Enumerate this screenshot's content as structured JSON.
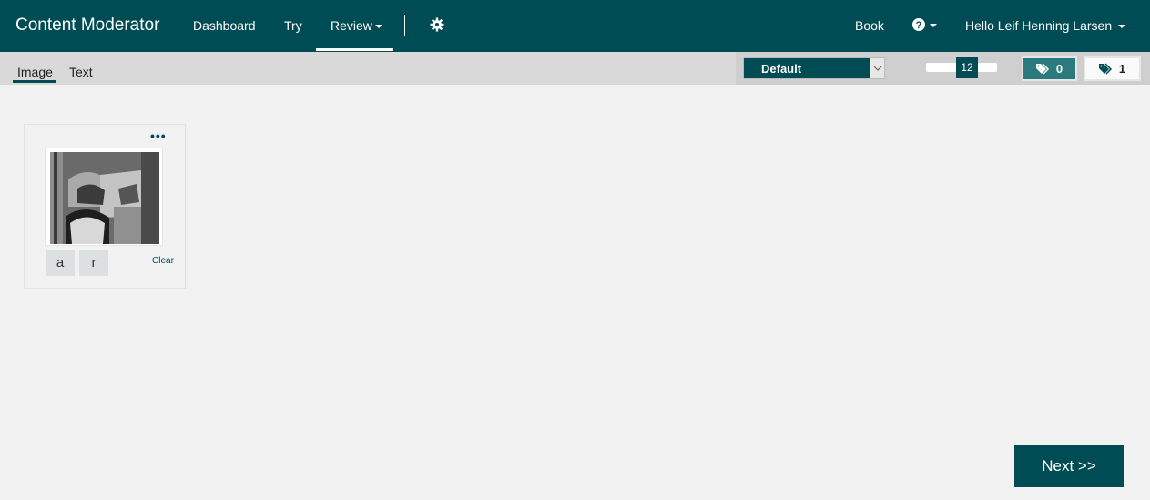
{
  "header": {
    "brand": "Content Moderator",
    "nav": {
      "dashboard": "Dashboard",
      "try": "Try",
      "review": "Review"
    },
    "book": "Book",
    "user_greeting": "Hello Leif Henning Larsen"
  },
  "subbar": {
    "tabs": {
      "image": "Image",
      "text": "Text"
    },
    "active_tab": "Image"
  },
  "toolbar": {
    "team_select": "Default",
    "page_size": "12",
    "tagged_count": "0",
    "untagged_count": "1"
  },
  "card": {
    "tags": [
      "a",
      "r"
    ],
    "clear_label": "Clear",
    "menu_icon": "more-icon"
  },
  "next_button": "Next >>",
  "colors": {
    "brand": "#004c54",
    "tag_dark": "#2a7a7e",
    "background": "#f2f2f2"
  }
}
